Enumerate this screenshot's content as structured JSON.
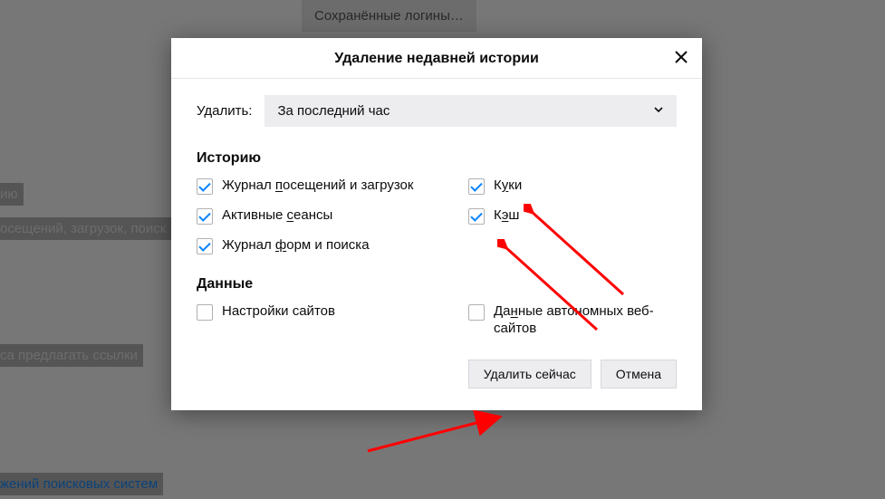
{
  "background": {
    "saved_logins_button": "Сохранённые логины…",
    "line1": "ию",
    "line2": "осещений, загрузок, поиск",
    "line3": "са предлагать ссылки",
    "line4": "жений поисковых систем"
  },
  "dialog": {
    "title": "Удаление недавней истории",
    "range_label": "Удалить:",
    "range_value": "За последний час",
    "sections": {
      "history": {
        "title": "Историю",
        "browsing": {
          "before": "Журнал ",
          "u": "п",
          "after": "осещений и загрузок"
        },
        "cookies": {
          "before": "К",
          "u": "у",
          "after": "ки"
        },
        "sessions": {
          "before": "Активные ",
          "u": "с",
          "after": "еансы"
        },
        "cache": {
          "before": "К",
          "u": "э",
          "after": "ш"
        },
        "forms": {
          "before": "Журнал ",
          "u": "ф",
          "after": "орм и поиска"
        }
      },
      "data": {
        "title": "Данные",
        "site_settings": "Настройки сайтов",
        "offline": {
          "before": "Да",
          "u": "н",
          "after": "ные автономных веб-сайтов"
        }
      }
    },
    "buttons": {
      "delete_now": "Удалить сейчас",
      "cancel": "Отмена"
    }
  }
}
